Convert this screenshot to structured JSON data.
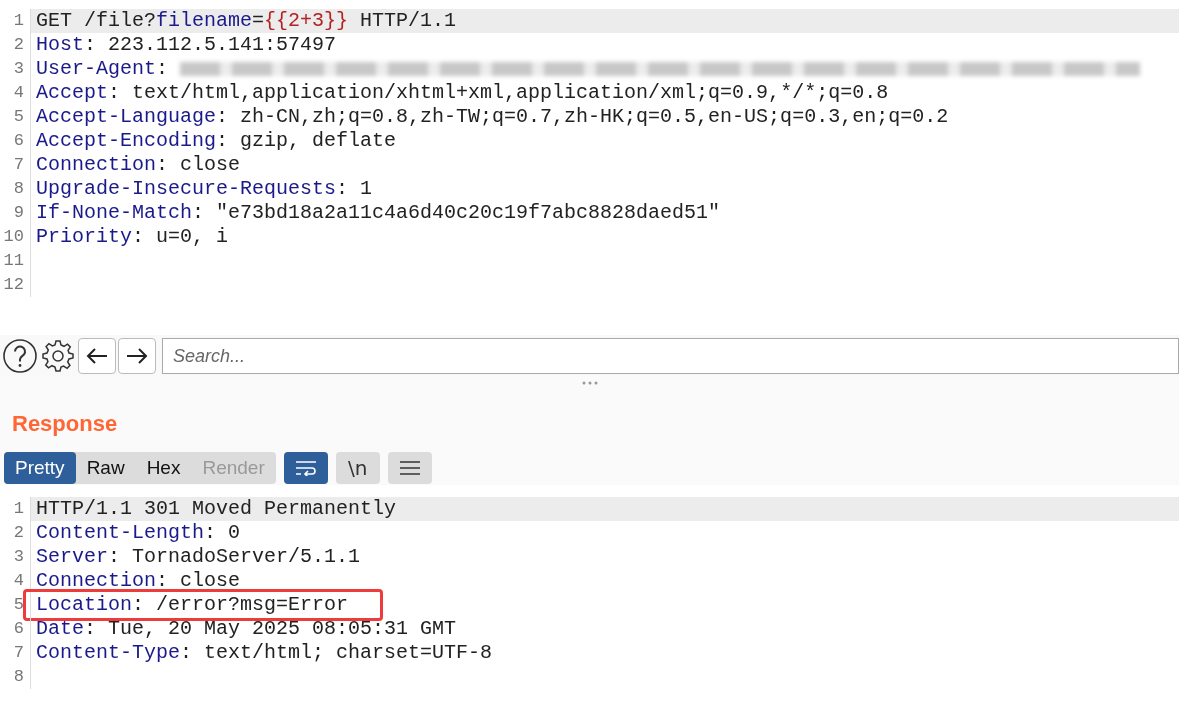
{
  "request": {
    "lines": [
      {
        "number": "1",
        "current": true,
        "segments": [
          {
            "kind": "plain",
            "text": "GET /file?"
          },
          {
            "kind": "name",
            "text": "filename"
          },
          {
            "kind": "plain",
            "text": "="
          },
          {
            "kind": "param",
            "text": "{{2+3}}"
          },
          {
            "kind": "plain",
            "text": " HTTP/1.1"
          }
        ]
      },
      {
        "number": "2",
        "current": false,
        "segments": [
          {
            "kind": "name",
            "text": "Host"
          },
          {
            "kind": "plain",
            "text": ": 223.112.5.141:57497"
          }
        ]
      },
      {
        "number": "3",
        "current": false,
        "segments": [
          {
            "kind": "name",
            "text": "User-Agent"
          },
          {
            "kind": "plain",
            "text": ":"
          },
          {
            "kind": "blurred"
          }
        ]
      },
      {
        "number": "4",
        "current": false,
        "segments": [
          {
            "kind": "name",
            "text": "Accept"
          },
          {
            "kind": "plain",
            "text": ": text/html,application/xhtml+xml,application/xml;q=0.9,*/*;q=0.8"
          }
        ]
      },
      {
        "number": "5",
        "current": false,
        "segments": [
          {
            "kind": "name",
            "text": "Accept-Language"
          },
          {
            "kind": "plain",
            "text": ": zh-CN,zh;q=0.8,zh-TW;q=0.7,zh-HK;q=0.5,en-US;q=0.3,en;q=0.2"
          }
        ]
      },
      {
        "number": "6",
        "current": false,
        "segments": [
          {
            "kind": "name",
            "text": "Accept-Encoding"
          },
          {
            "kind": "plain",
            "text": ": gzip, deflate"
          }
        ]
      },
      {
        "number": "7",
        "current": false,
        "segments": [
          {
            "kind": "name",
            "text": "Connection"
          },
          {
            "kind": "plain",
            "text": ": close"
          }
        ]
      },
      {
        "number": "8",
        "current": false,
        "segments": [
          {
            "kind": "name",
            "text": "Upgrade-Insecure-Requests"
          },
          {
            "kind": "plain",
            "text": ": 1"
          }
        ]
      },
      {
        "number": "9",
        "current": false,
        "segments": [
          {
            "kind": "name",
            "text": "If-None-Match"
          },
          {
            "kind": "plain",
            "text": ": \"e73bd18a2a11c4a6d40c20c19f7abc8828daed51\""
          }
        ]
      },
      {
        "number": "10",
        "current": false,
        "segments": [
          {
            "kind": "name",
            "text": "Priority"
          },
          {
            "kind": "plain",
            "text": ": u=0, i"
          }
        ]
      },
      {
        "number": "11",
        "current": false
      },
      {
        "number": "12",
        "current": false
      }
    ]
  },
  "toolbar": {
    "search": {
      "placeholder": "Search..."
    }
  },
  "response": {
    "title": "Response",
    "tabs": [
      {
        "label": "Pretty",
        "selected": true,
        "disabled": false
      },
      {
        "label": "Raw",
        "selected": false,
        "disabled": false
      },
      {
        "label": "Hex",
        "selected": false,
        "disabled": false
      },
      {
        "label": "Render",
        "selected": false,
        "disabled": true
      }
    ],
    "tools": [
      {
        "kind": "wrap",
        "selected": true
      },
      {
        "kind": "newlines",
        "label": "\\n",
        "selected": false
      },
      {
        "kind": "menu",
        "selected": false
      }
    ],
    "lines": [
      {
        "number": "1",
        "current": true,
        "highlighted": false,
        "segments": [
          {
            "kind": "plain",
            "text": "HTTP/1.1 301 Moved Permanently"
          }
        ]
      },
      {
        "number": "2",
        "current": false,
        "highlighted": false,
        "segments": [
          {
            "kind": "name",
            "text": "Content-Length"
          },
          {
            "kind": "plain",
            "text": ": 0"
          }
        ]
      },
      {
        "number": "3",
        "current": false,
        "highlighted": false,
        "segments": [
          {
            "kind": "name",
            "text": "Server"
          },
          {
            "kind": "plain",
            "text": ": TornadoServer/5.1.1"
          }
        ]
      },
      {
        "number": "4",
        "current": false,
        "highlighted": false,
        "segments": [
          {
            "kind": "name",
            "text": "Connection"
          },
          {
            "kind": "plain",
            "text": ": close"
          }
        ]
      },
      {
        "number": "5",
        "current": false,
        "highlighted": true,
        "segments": [
          {
            "kind": "name",
            "text": "Location"
          },
          {
            "kind": "plain",
            "text": ": /error?msg=Error"
          }
        ]
      },
      {
        "number": "6",
        "current": false,
        "highlighted": false,
        "segments": [
          {
            "kind": "name",
            "text": "Date"
          },
          {
            "kind": "plain",
            "text": ": Tue, 20 May 2025 08:05:31 GMT"
          }
        ]
      },
      {
        "number": "7",
        "current": false,
        "highlighted": false,
        "segments": [
          {
            "kind": "name",
            "text": "Content-Type"
          },
          {
            "kind": "plain",
            "text": ": text/html; charset=UTF-8"
          }
        ]
      },
      {
        "number": "8",
        "current": false,
        "highlighted": false
      }
    ]
  }
}
